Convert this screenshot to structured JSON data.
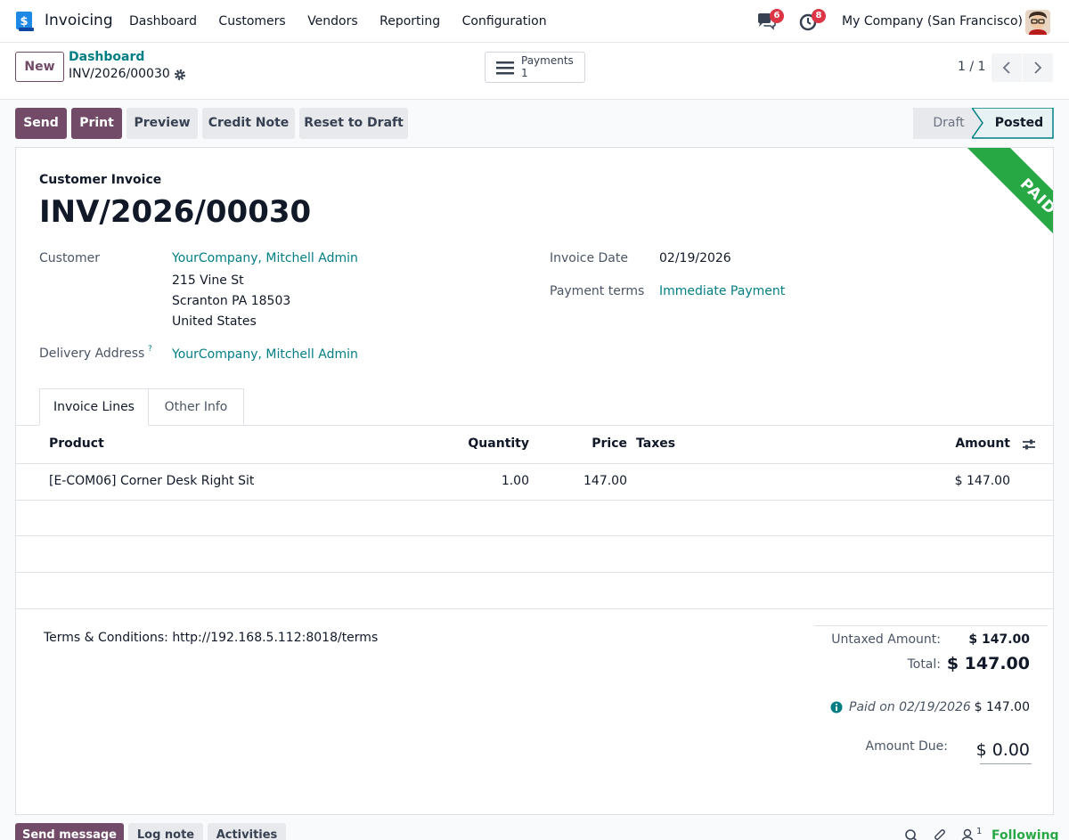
{
  "navbar": {
    "app_name": "Invoicing",
    "menu": [
      "Dashboard",
      "Customers",
      "Vendors",
      "Reporting",
      "Configuration"
    ],
    "messages_count": "6",
    "activities_count": "8",
    "company": "My Company (San Francisco)"
  },
  "control": {
    "new_label": "New",
    "breadcrumb": "Dashboard",
    "record_name": "INV/2026/00030",
    "payments_label": "Payments",
    "payments_count": "1",
    "pager": "1 / 1"
  },
  "actions": {
    "send": "Send",
    "print": "Print",
    "preview": "Preview",
    "credit_note": "Credit Note",
    "reset": "Reset to Draft"
  },
  "status": {
    "draft": "Draft",
    "posted": "Posted"
  },
  "sheet": {
    "ribbon": "PAID",
    "subtitle": "Customer Invoice",
    "title": "INV/2026/00030",
    "customer_label": "Customer",
    "customer_name": "YourCompany, Mitchell Admin",
    "address_line1": "215 Vine St",
    "address_line2": "Scranton PA 18503",
    "address_line3": "United States",
    "delivery_label": "Delivery Address",
    "delivery_help": "?",
    "delivery_value": "YourCompany, Mitchell Admin",
    "invoice_date_label": "Invoice Date",
    "invoice_date": "02/19/2026",
    "payment_terms_label": "Payment terms",
    "payment_terms": "Immediate Payment"
  },
  "tabs": [
    "Invoice Lines",
    "Other Info"
  ],
  "table": {
    "headers": {
      "product": "Product",
      "quantity": "Quantity",
      "price": "Price",
      "taxes": "Taxes",
      "amount": "Amount"
    },
    "rows": [
      {
        "product": "[E-COM06] Corner Desk Right Sit",
        "quantity": "1.00",
        "price": "147.00",
        "taxes": "",
        "amount": "$ 147.00"
      }
    ]
  },
  "totals": {
    "terms": "Terms & Conditions: http://192.168.5.112:8018/terms",
    "untaxed_label": "Untaxed Amount:",
    "untaxed_value": "$ 147.00",
    "total_label": "Total:",
    "total_value": "$ 147.00",
    "paid_on": "Paid on 02/19/2026",
    "paid_value": "$ 147.00",
    "due_label": "Amount Due:",
    "due_value": "$ 0.00"
  },
  "chatter": {
    "send_message": "Send message",
    "log_note": "Log note",
    "activities": "Activities",
    "followers_count": "1",
    "following": "Following"
  }
}
